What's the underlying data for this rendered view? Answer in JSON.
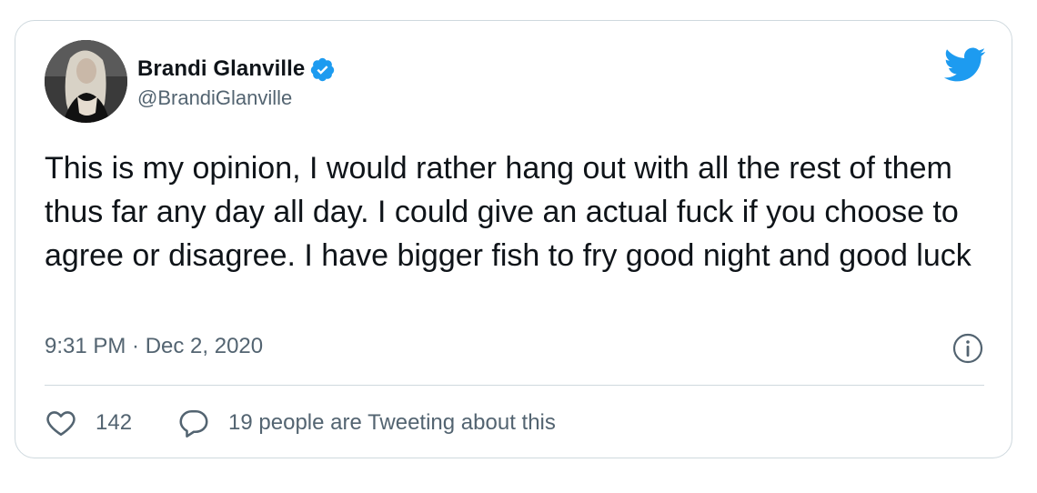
{
  "author": {
    "display_name": "Brandi Glanville",
    "handle": "@BrandiGlanville",
    "verified": true
  },
  "icons": {
    "verified": "verified-badge-icon",
    "brand": "twitter-bird-icon",
    "info": "info-icon",
    "like": "heart-icon",
    "reply": "reply-bubble-icon"
  },
  "tweet": {
    "text": "This is my opinion, I would rather hang out with all the rest of them thus far any day all day. I could give an actual fuck if you choose to agree or disagree. I have bigger fish to fry good night and good luck",
    "timestamp": "9:31 PM · Dec 2, 2020"
  },
  "engagement": {
    "likes": "142",
    "tweeting_label": "19 people are Tweeting about this"
  },
  "colors": {
    "twitter_blue": "#1d9bf0",
    "text_primary": "#0f1419",
    "text_secondary": "#536471",
    "border": "#cfd9de"
  }
}
